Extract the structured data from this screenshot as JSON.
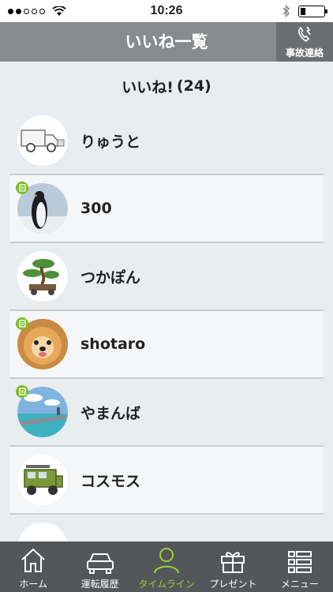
{
  "status_bar": {
    "time": "10:26"
  },
  "header": {
    "title": "いいね一覧",
    "emergency_label": "事故連絡"
  },
  "likes": {
    "label": "いいね!",
    "count": "(24)"
  },
  "users": [
    {
      "name": "りゅうと",
      "avatar": "white-truck-icon",
      "badge": false
    },
    {
      "name": "300",
      "avatar": "penguin-photo",
      "badge": true
    },
    {
      "name": "つかぽん",
      "avatar": "bonsai-cart-icon",
      "badge": false
    },
    {
      "name": "shotaro",
      "avatar": "dog-photo",
      "badge": true
    },
    {
      "name": "やまんば",
      "avatar": "seaside-photo",
      "badge": true
    },
    {
      "name": "コスモス",
      "avatar": "green-jeep-icon",
      "badge": false
    }
  ],
  "tabs": [
    {
      "label": "ホーム",
      "icon": "home-icon"
    },
    {
      "label": "運転履歴",
      "icon": "car-icon"
    },
    {
      "label": "タイムライン",
      "icon": "person-icon",
      "active": true
    },
    {
      "label": "プレゼント",
      "icon": "gift-icon"
    },
    {
      "label": "メニュー",
      "icon": "menu-list-icon"
    }
  ],
  "colors": {
    "header": "#888b8d",
    "tabbar": "#535759",
    "accent": "#9dcf3a",
    "badge": "#7dbb2a"
  }
}
